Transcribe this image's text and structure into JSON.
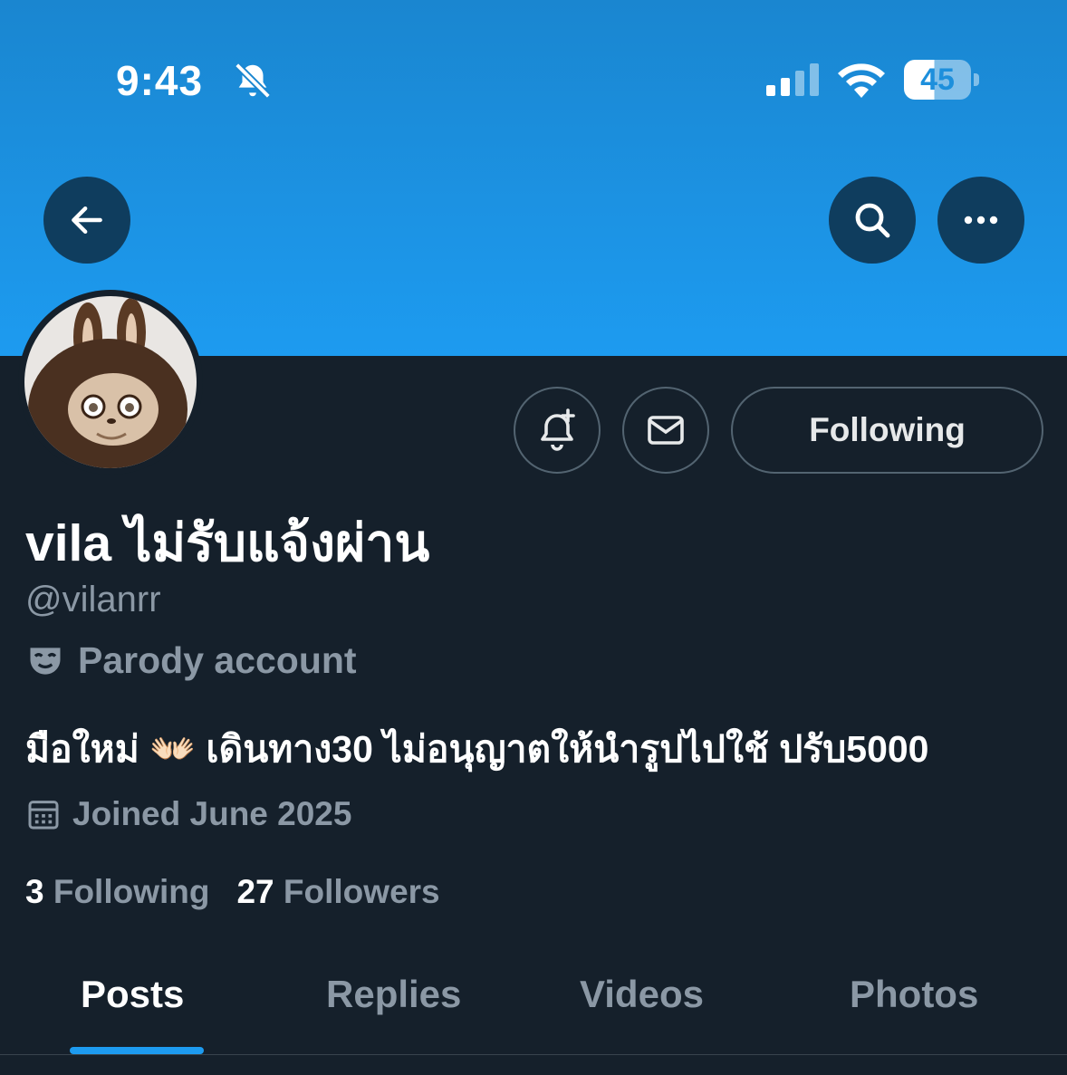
{
  "status_bar": {
    "time": "9:43",
    "battery": "45",
    "icons": [
      "bell-off-icon",
      "signal-icon",
      "wifi-icon",
      "battery-icon"
    ]
  },
  "header": {
    "back_icon": "arrow-left-icon",
    "search_icon": "search-icon",
    "more_icon": "more-horizontal-icon",
    "banner_color": "#1d9bf0"
  },
  "profile": {
    "display_name": "vila ไม่รับแจ้งผ่าน",
    "handle": "@vilanrr",
    "parody_label": "Parody account",
    "bio": "มือใหม่ 👐🏻 เดินทาง30 ไม่อนุญาตให้นำรูปไปใช้ ปรับ5000",
    "joined": "Joined June 2025",
    "following_count": "3",
    "following_label": "Following",
    "followers_count": "27",
    "followers_label": "Followers"
  },
  "actions": {
    "notify_icon": "bell-plus-icon",
    "message_icon": "envelope-icon",
    "following_button": "Following"
  },
  "tabs": [
    {
      "label": "Posts",
      "active": true
    },
    {
      "label": "Replies",
      "active": false
    },
    {
      "label": "Videos",
      "active": false
    },
    {
      "label": "Photos",
      "active": false
    }
  ],
  "colors": {
    "background": "#15202b",
    "accent": "#1d9bf0",
    "secondary_text": "#8b98a5"
  }
}
